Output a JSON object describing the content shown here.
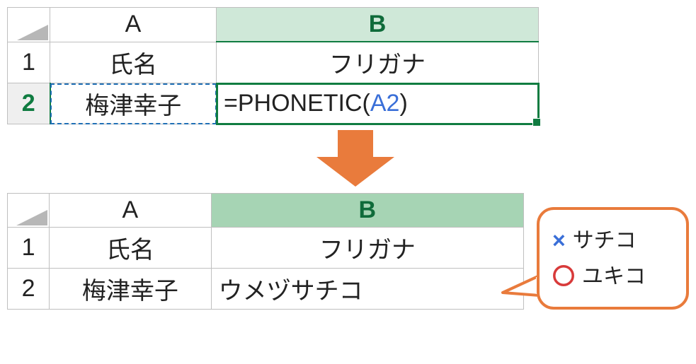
{
  "top": {
    "cols": {
      "A": "A",
      "B": "B"
    },
    "rows": {
      "r1": "1",
      "r2": "2"
    },
    "headers": {
      "name": "氏名",
      "furi": "フリガナ"
    },
    "A2": "梅津幸子",
    "B2_prefix": "=PHONETIC(",
    "B2_ref": "A2",
    "B2_suffix": ")"
  },
  "bottom": {
    "cols": {
      "A": "A",
      "B": "B"
    },
    "rows": {
      "r1": "1",
      "r2": "2"
    },
    "headers": {
      "name": "氏名",
      "furi": "フリガナ"
    },
    "A2": "梅津幸子",
    "B2": "ウメヅサチコ"
  },
  "callout": {
    "wrong_mark": "×",
    "wrong_text": "サチコ",
    "right_mark": "〇",
    "right_text": "ユキコ"
  }
}
